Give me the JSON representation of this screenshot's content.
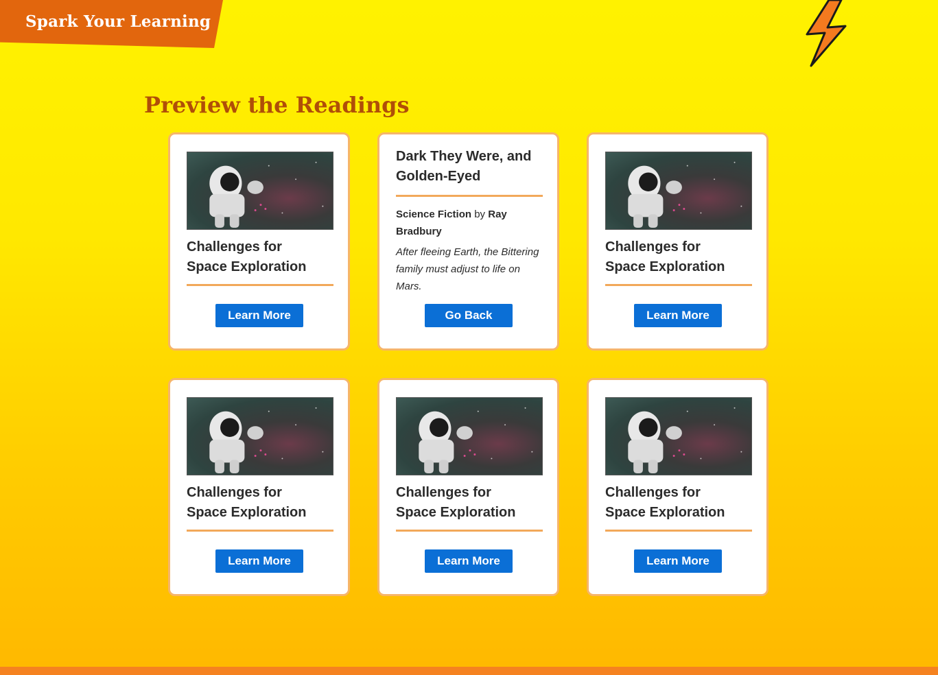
{
  "header": {
    "banner_text": "Spark Your Learning"
  },
  "page_title": "Preview the Readings",
  "icons": {
    "bolt": "lightning-bolt-icon",
    "thumbnail": "astronaut-image"
  },
  "colors": {
    "accent": "#e2660d",
    "title": "#b04e08",
    "button": "#0b6fd6",
    "card_border": "#f6b56a",
    "rule": "#f2a85a"
  },
  "cards": [
    {
      "title_line1": "Challenges for",
      "title_line2": "Space Exploration",
      "button": "Learn More"
    },
    {
      "title_line1": "Dark They Were, and",
      "title_line2": "Golden-Eyed",
      "genre": "Science Fiction",
      "by": "by",
      "author": "Ray Bradbury",
      "description": "After fleeing Earth, the Bittering family must adjust to life on Mars.",
      "button": "Go Back"
    },
    {
      "title_line1": "Challenges for",
      "title_line2": "Space Exploration",
      "button": "Learn More"
    },
    {
      "title_line1": "Challenges for",
      "title_line2": "Space Exploration",
      "button": "Learn More"
    },
    {
      "title_line1": "Challenges for",
      "title_line2": "Space Exploration",
      "button": "Learn More"
    },
    {
      "title_line1": "Challenges for",
      "title_line2": "Space Exploration",
      "button": "Learn More"
    }
  ]
}
